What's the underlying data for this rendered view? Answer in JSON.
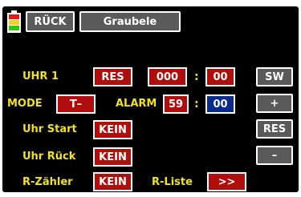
{
  "header": {
    "back_label": "RÜCK",
    "title": "Graubele"
  },
  "battery": {
    "icon": "battery-icon",
    "segment_colors": [
      "#39c21a",
      "#f0d11b",
      "#e11c1c"
    ]
  },
  "rows": {
    "uhr1": {
      "label": "UHR 1",
      "reset_label": "RES",
      "minutes": "000",
      "colon": ":",
      "seconds": "00"
    },
    "mode": {
      "label": "MODE",
      "value": "T–",
      "alarm_label": "ALARM",
      "alarm_minutes": "59",
      "colon": ":",
      "alarm_seconds": "00"
    },
    "uhr_start": {
      "label": "Uhr Start",
      "value": "KEIN"
    },
    "uhr_rueck": {
      "label": "Uhr Rück",
      "value": "KEIN"
    },
    "r_zaehler": {
      "label": "R-Zähler",
      "value": "KEIN",
      "list_label": "R-Liste",
      "list_button": ">>"
    }
  },
  "side_buttons": {
    "sw": "SW",
    "plus": "+",
    "res": "RES",
    "minus": "–"
  },
  "colors": {
    "label_yellow": "#f2e21c",
    "button_red": "#b00d0d",
    "button_blue": "#0a2a8c",
    "button_gray": "#5a5a5a",
    "panel_black": "#000000"
  }
}
